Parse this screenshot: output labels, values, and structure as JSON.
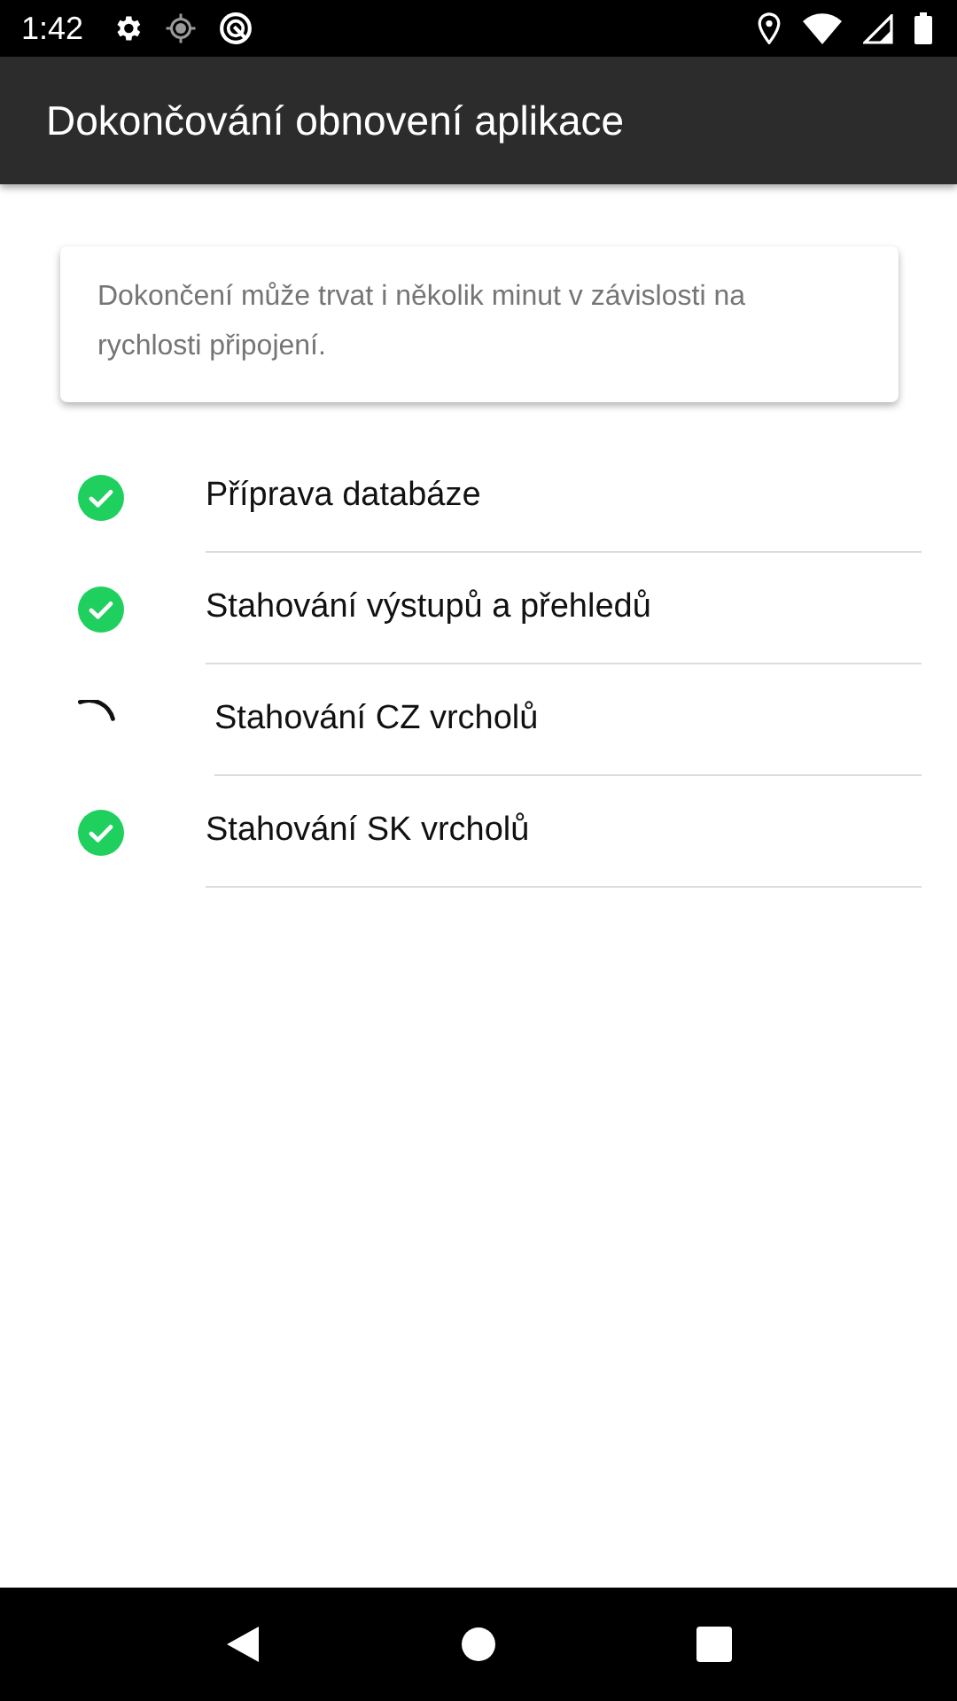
{
  "status_bar": {
    "time": "1:42"
  },
  "app_bar": {
    "title": "Dokončování obnovení aplikace"
  },
  "notice": {
    "text": "Dokončení může trvat i několik minut v závislosti na rychlosti připojení."
  },
  "steps": [
    {
      "label": "Příprava databáze",
      "kind": "done"
    },
    {
      "label": "Stahování výstupů a přehledů",
      "kind": "done"
    },
    {
      "label": "Stahování CZ vrcholů",
      "kind": "loading"
    },
    {
      "label": "Stahování SK vrcholů",
      "kind": "done"
    }
  ]
}
